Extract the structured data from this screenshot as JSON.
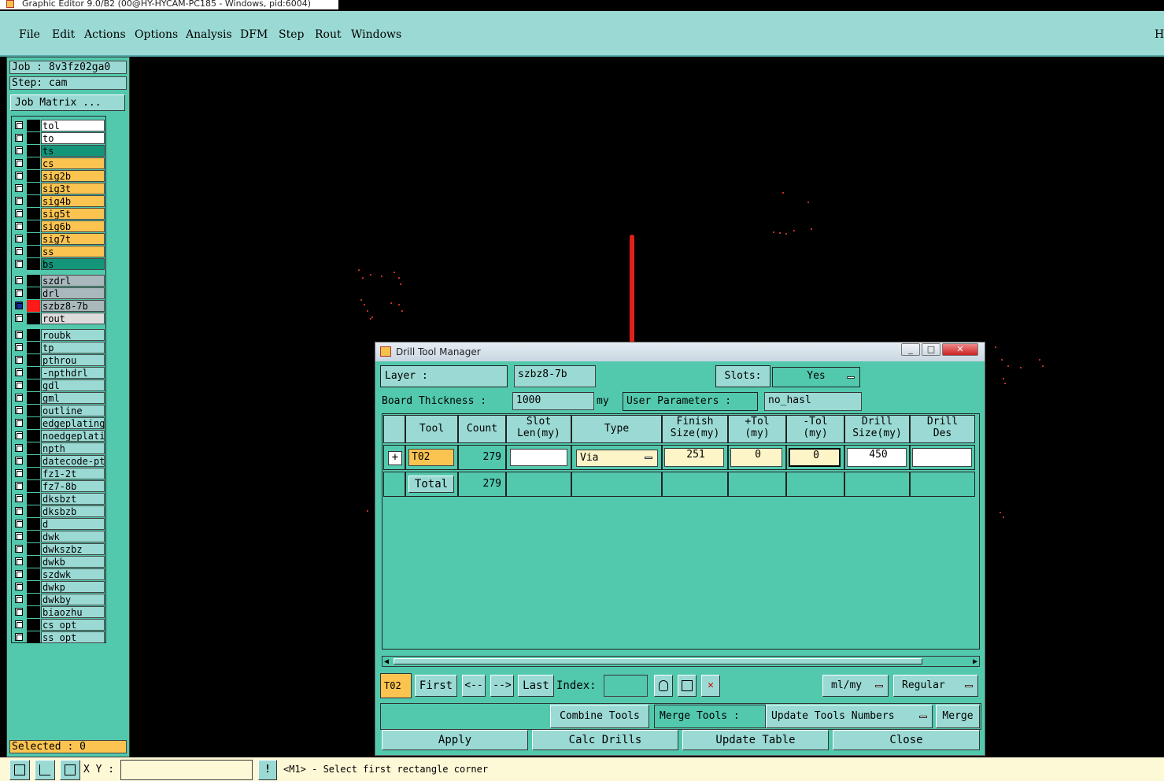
{
  "window": {
    "title": "Graphic Editor 9.0/B2 (00@HY-HYCAM-PC185 - Windows, pid:6004)"
  },
  "menu": {
    "items": [
      "File",
      "Edit",
      "Actions",
      "Options",
      "Analysis",
      "DFM",
      "Step",
      "Rout",
      "Windows"
    ],
    "help": "H"
  },
  "left": {
    "job": "Job : 8v3fz02ga0",
    "step": "Step: cam",
    "job_matrix": "Job Matrix ...",
    "selected": "Selected : 0"
  },
  "layers": [
    {
      "name": "tol",
      "color": "#ffffff"
    },
    {
      "name": "to",
      "color": "#ffffff"
    },
    {
      "name": "ts",
      "color": "#13957a"
    },
    {
      "name": "cs",
      "color": "#fbc451"
    },
    {
      "name": "sig2b",
      "color": "#fbc451"
    },
    {
      "name": "sig3t",
      "color": "#fbc451"
    },
    {
      "name": "sig4b",
      "color": "#fbc451"
    },
    {
      "name": "sig5t",
      "color": "#fbc451"
    },
    {
      "name": "sig6b",
      "color": "#fbc451"
    },
    {
      "name": "sig7t",
      "color": "#fbc451"
    },
    {
      "name": "ss",
      "color": "#fbc451"
    },
    {
      "name": "bs",
      "color": "#13957a"
    },
    {
      "name": "szdrl",
      "color": "#a9b8bc"
    },
    {
      "name": "drl",
      "color": "#a9b8bc"
    },
    {
      "name": "szbz8-7b",
      "color": "#a9b8bc"
    },
    {
      "name": "rout",
      "color": "#dcdcdc"
    },
    {
      "name": "roubk",
      "color": "#9bdad4"
    },
    {
      "name": "tp",
      "color": "#9bdad4"
    },
    {
      "name": "pthrou",
      "color": "#9bdad4"
    },
    {
      "name": "-npthdrl",
      "color": "#9bdad4"
    },
    {
      "name": "gdl",
      "color": "#9bdad4"
    },
    {
      "name": "gml",
      "color": "#9bdad4"
    },
    {
      "name": "outline",
      "color": "#9bdad4"
    },
    {
      "name": "edgeplating",
      "color": "#9bdad4"
    },
    {
      "name": "noedgeplatin",
      "color": "#9bdad4"
    },
    {
      "name": "npth",
      "color": "#9bdad4"
    },
    {
      "name": "datecode-pte",
      "color": "#9bdad4"
    },
    {
      "name": "fz1-2t",
      "color": "#9bdad4"
    },
    {
      "name": "fz7-8b",
      "color": "#9bdad4"
    },
    {
      "name": "dksbzt",
      "color": "#9bdad4"
    },
    {
      "name": "dksbzb",
      "color": "#9bdad4"
    },
    {
      "name": "d",
      "color": "#9bdad4"
    },
    {
      "name": "dwk",
      "color": "#9bdad4"
    },
    {
      "name": "dwkszbz",
      "color": "#9bdad4"
    },
    {
      "name": "dwkb",
      "color": "#9bdad4"
    },
    {
      "name": "szdwk",
      "color": "#9bdad4"
    },
    {
      "name": "dwkp",
      "color": "#9bdad4"
    },
    {
      "name": "dwkby",
      "color": "#9bdad4"
    },
    {
      "name": "biaozhu",
      "color": "#9bdad4"
    },
    {
      "name": "cs_opt",
      "color": "#9bdad4"
    },
    {
      "name": "ss_opt",
      "color": "#9bdad4"
    }
  ],
  "dialog": {
    "title": "Drill Tool Manager",
    "layer_label": "Layer          :",
    "layer_value": "szbz8-7b",
    "slots_label": "Slots:",
    "slots_value": "Yes",
    "board_thickness_label": "Board Thickness :",
    "board_thickness_value": "1000",
    "unit": "my",
    "user_params_label": "User Parameters :",
    "user_params_value": "no_hasl",
    "headers": {
      "tool": "Tool",
      "count": "Count",
      "slot1": "Slot",
      "slot2": "Len(my)",
      "type": "Type",
      "finish1": "Finish",
      "finish2": "Size(my)",
      "ptol1": "+Tol",
      "ptol2": "(my)",
      "mtol1": "-Tol",
      "mtol2": "(my)",
      "drill1": "Drill",
      "drill2": "Size(my)",
      "des1": "Drill",
      "des2": "Des"
    },
    "row": {
      "tool": "T02",
      "count": "279",
      "slot_len": "",
      "type": "Via",
      "finish": "251",
      "ptol": "0",
      "mtol": "0",
      "drill_size": "450",
      "drill_des": ""
    },
    "total": {
      "label": "Total",
      "count": "279"
    },
    "nav": {
      "current": "T02",
      "first": "First",
      "prev": "<--",
      "next": "-->",
      "last": "Last",
      "index_label": "Index:",
      "units": "ml/my",
      "mode": "Regular"
    },
    "actions": {
      "combine": "Combine Tools",
      "merge_tools": "Merge Tools  :",
      "update_numbers": "Update Tools Numbers",
      "merge": "Merge"
    },
    "bottom": {
      "apply": "Apply",
      "calc": "Calc Drills",
      "update": "Update Table",
      "close": "Close"
    }
  },
  "status": {
    "xy_label": "X Y :",
    "message": "<M1> - Select first rectangle corner"
  }
}
